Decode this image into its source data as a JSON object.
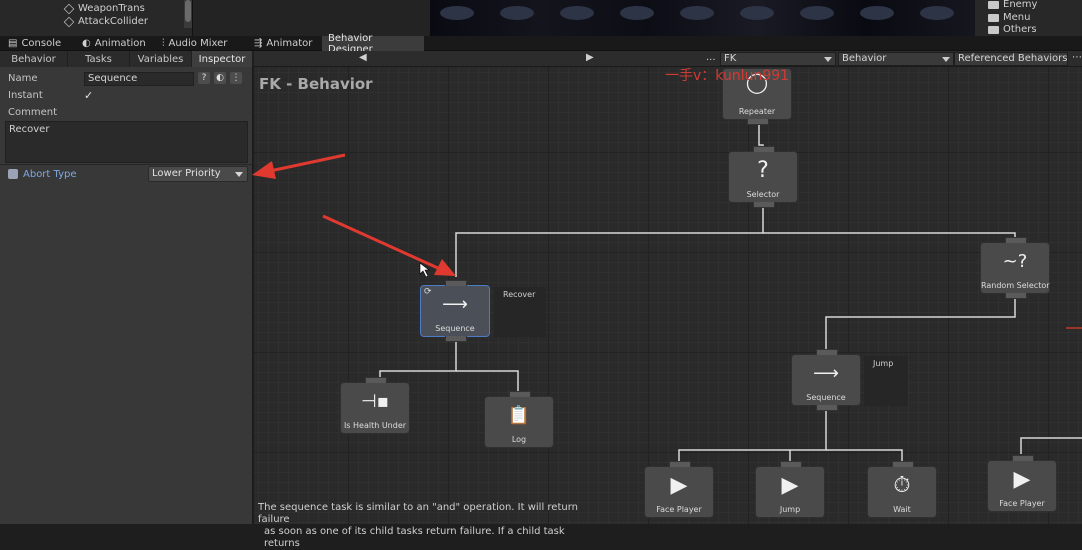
{
  "hierarchy": {
    "items": [
      "WeaponTrans",
      "AttackCollider"
    ]
  },
  "project": {
    "folders": [
      "Enemy",
      "Menu",
      "Others"
    ]
  },
  "window_tabs": [
    {
      "label": "Console",
      "icon": "console-icon"
    },
    {
      "label": "Animation",
      "icon": "animation-icon"
    },
    {
      "label": "Audio Mixer",
      "icon": "audio-mixer-icon"
    },
    {
      "label": "Animator",
      "icon": "animator-icon"
    },
    {
      "label": "Behavior Designer",
      "icon": ""
    }
  ],
  "panel_tabs": [
    "Behavior",
    "Tasks",
    "Variables",
    "Inspector"
  ],
  "inspector": {
    "name_label": "Name",
    "name_value": "Sequence",
    "instant_label": "Instant",
    "instant_checked": true,
    "instant_mark": "✓",
    "comment_label": "Comment",
    "comment_value": "Recover",
    "abort_label": "Abort Type",
    "abort_value": "Lower Priority"
  },
  "graph_toolbar": {
    "prev": "◀",
    "next": "▶",
    "ellipsis": "...",
    "object": "FK",
    "behavior": "Behavior",
    "referenced": "Referenced Behaviors"
  },
  "graph": {
    "title": "FK - Behavior",
    "watermark": "一手v：kunlun991",
    "nodes": {
      "repeater": "Repeater",
      "selector": "Selector",
      "sequence_recover": "Sequence",
      "random_selector": "Random Selector",
      "is_health_under": "Is Health Under",
      "log": "Log",
      "sequence_jump": "Sequence",
      "face_player_1": "Face Player",
      "jump": "Jump",
      "wait": "Wait",
      "face_player_2": "Face Player"
    },
    "comments": {
      "recover": "Recover",
      "jump": "Jump"
    },
    "description_line1": "The sequence task is similar to an \"and\" operation. It will return failure",
    "description_line2": "as soon as one of its child tasks return failure. If a child task returns"
  },
  "colors": {
    "accent_select": "#4d7bc4",
    "arrow": "#e03a30",
    "abort_label": "#7fa8e0"
  }
}
